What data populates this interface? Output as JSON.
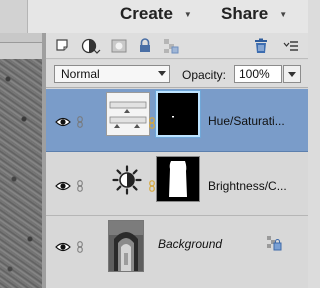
{
  "topbar": {
    "create_label": "Create",
    "share_label": "Share"
  },
  "layers_panel": {
    "blend_mode": "Normal",
    "opacity_label": "Opacity:",
    "opacity_value": "100%",
    "layers": [
      {
        "name": "Hue/Saturati...",
        "selected": true
      },
      {
        "name": "Brightness/C...",
        "selected": false
      },
      {
        "name": "Background",
        "selected": false
      }
    ]
  },
  "colors": {
    "selected_row": "#7a9cc9",
    "panel_bg": "#d8d8d8",
    "chain_link": "#d8a83a"
  },
  "icons": [
    "new-layer-icon",
    "fill-adjustment-icon",
    "add-mask-icon",
    "lock-all-icon",
    "lock-transparency-icon",
    "trash-icon",
    "panel-menu-icon",
    "eye-icon",
    "chain-icon",
    "layer-link-icon",
    "brightness-icon"
  ]
}
